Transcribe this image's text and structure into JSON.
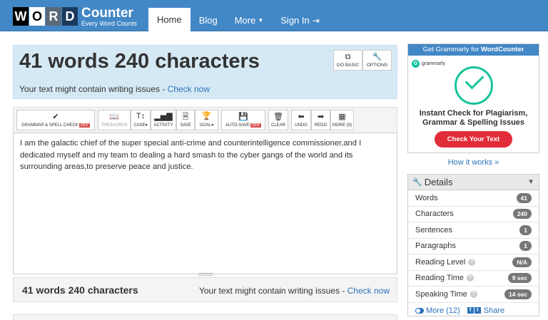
{
  "logo": {
    "letters": [
      "W",
      "O",
      "R",
      "D"
    ],
    "name": "Counter",
    "tagline": "Every Word Counts"
  },
  "nav": {
    "items": [
      {
        "label": "Home",
        "active": true
      },
      {
        "label": "Blog"
      },
      {
        "label": "More",
        "dropdown": true
      },
      {
        "label": "Sign In",
        "icon": "sign-in-icon"
      }
    ]
  },
  "stats": {
    "title": "41 words 240 characters",
    "warning_text": "Your text might contain writing issues - ",
    "warning_link": "Check now",
    "buttons": [
      {
        "label": "GO BASIC",
        "icon": "external-link-icon"
      },
      {
        "label": "OPTIONS",
        "icon": "wrench-icon"
      }
    ]
  },
  "toolbar": {
    "items": [
      {
        "label": "GRAMMAR & SPELL CHECK",
        "badge": "OFF",
        "icon": "check-icon"
      },
      {
        "label": "THESAURUS",
        "icon": "book-icon",
        "disabled": true
      },
      {
        "label": "CASE",
        "icon": "text-height-icon",
        "dropdown": true
      },
      {
        "label": "ACTIVITY",
        "icon": "bar-chart-icon"
      },
      {
        "label": "SAVE",
        "icon": "save-file-icon"
      },
      {
        "label": "GOAL",
        "icon": "trophy-icon",
        "dropdown": true
      },
      {
        "label": "AUTO-SAVE",
        "badge": "OFF",
        "icon": "floppy-icon"
      },
      {
        "label": "CLEAR",
        "icon": "trash-icon"
      },
      {
        "label": "UNDO",
        "icon": "arrow-left-icon"
      },
      {
        "label": "REDO",
        "icon": "arrow-right-icon"
      },
      {
        "label": "MORE (9)",
        "icon": "grid-icon"
      }
    ]
  },
  "editor": {
    "text": "I am the galactic chief of the super special anti-crime and counterintelligence commissioner,and I dedicated myself and my team to dealing a hard smash to the cyber gangs of the world and its surrounding areas,to preserve peace and justice."
  },
  "bottom": {
    "count": "41 words 240 characters",
    "warning_text": "Your text might contain writing issues - ",
    "warning_link": "Check now"
  },
  "ad": {
    "header_prefix": "Get Grammarly for ",
    "header_brand": "WordCounter",
    "logo_text": "grammarly",
    "logo_letter": "G",
    "headline_line1": "Instant Check for Plagiarism,",
    "headline_line2": "Grammar & Spelling Issues",
    "button": "Check Your Text",
    "brand_color": "#15c39a",
    "button_color": "#e12d39"
  },
  "how_it_works": "How it works »",
  "details": {
    "title": "Details",
    "rows": [
      {
        "label": "Words",
        "value": "41"
      },
      {
        "label": "Characters",
        "value": "240"
      },
      {
        "label": "Sentences",
        "value": "1"
      },
      {
        "label": "Paragraphs",
        "value": "1"
      },
      {
        "label": "Reading Level",
        "value": "N/A",
        "help": true
      },
      {
        "label": "Reading Time",
        "value": "9 sec",
        "help": true
      },
      {
        "label": "Speaking Time",
        "value": "14 sec",
        "help": true
      }
    ],
    "more_label": "More (12)",
    "share_label": "Share"
  },
  "colors": {
    "navbar": "#4287c6",
    "stats_bg": "#d5e9f5",
    "link": "#2a72b8",
    "badge_off": "#d9534f"
  }
}
